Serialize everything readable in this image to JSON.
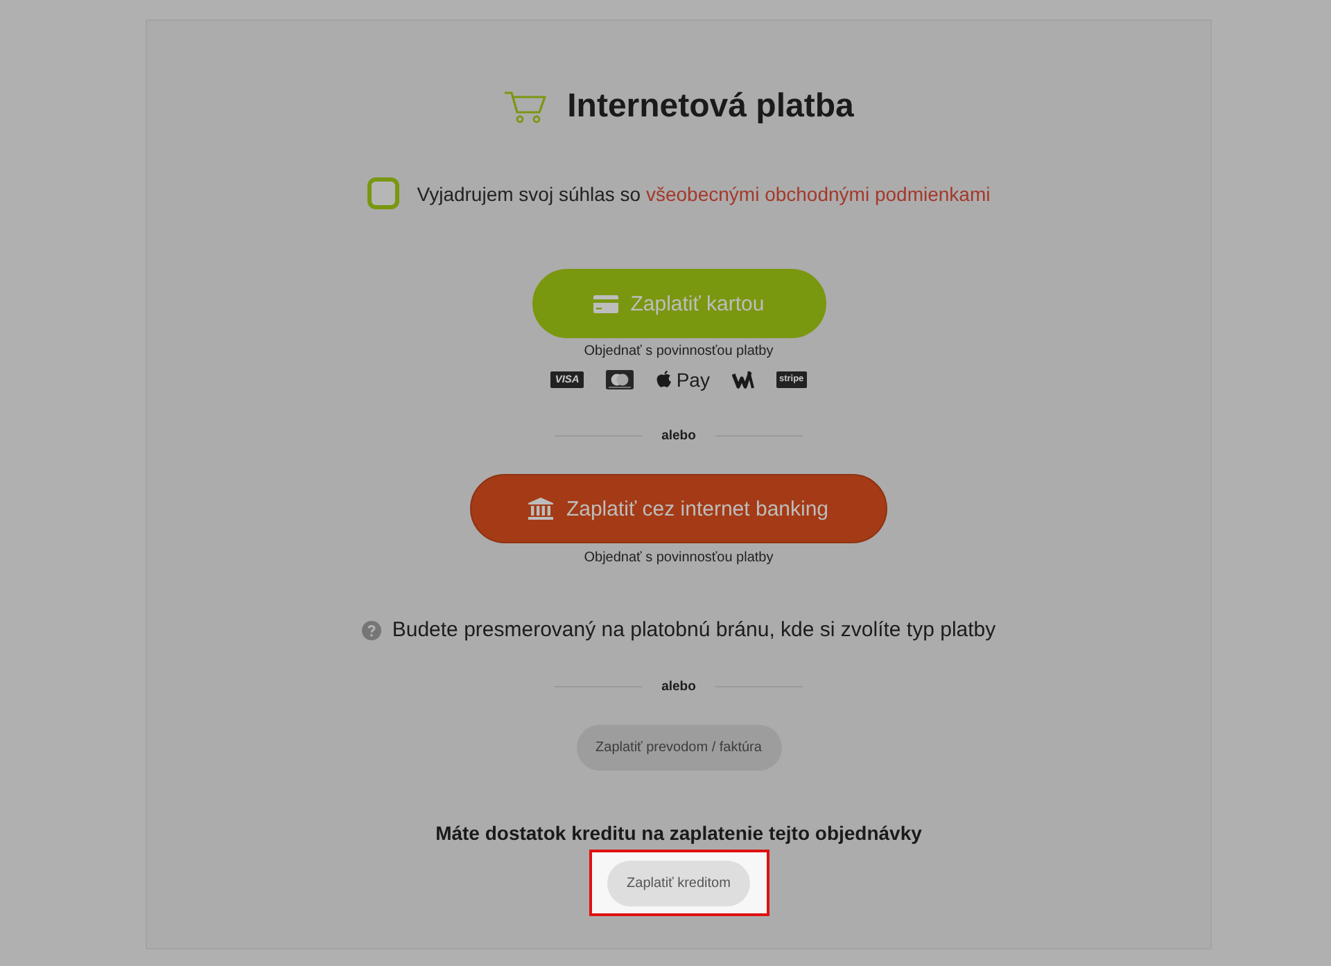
{
  "header": {
    "title": "Internetová platba"
  },
  "consent": {
    "checked": false,
    "text": "Vyjadrujem svoj súhlas so",
    "link": "všeobecnými obchodnými podmienkami"
  },
  "card_payment": {
    "button": "Zaplatiť kartou",
    "note": "Objednať s povinnosťou platby",
    "methods": [
      {
        "kind": "visa",
        "label": "VISA"
      },
      {
        "kind": "mastercard"
      },
      {
        "kind": "applepay",
        "label": "Pay"
      },
      {
        "kind": "wmark"
      },
      {
        "kind": "stripe",
        "label": "stripe"
      }
    ]
  },
  "separator_1": "alebo",
  "bank_payment": {
    "button": "Zaplatiť cez internet banking",
    "note": "Objednať s povinnosťou platby"
  },
  "redirect_info": "Budete presmerovaný na platobnú bránu, kde si zvolíte typ platby",
  "separator_2": "alebo",
  "transfer_button": "Zaplatiť prevodom / faktúra",
  "credit": {
    "heading": "Máte dostatok kreditu na zaplatenie tejto objednávky",
    "button": "Zaplatiť kreditom",
    "highlighted": true
  }
}
